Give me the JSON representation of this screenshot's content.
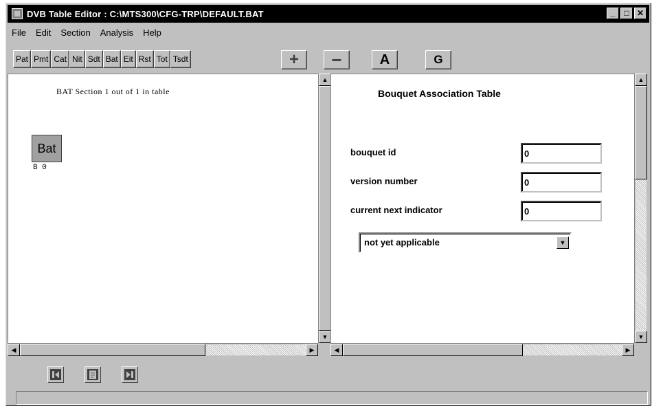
{
  "window": {
    "title": "DVB Table Editor : C:\\MTS300\\CFG-TRP\\DEFAULT.BAT",
    "controls": {
      "minimize": "_",
      "maximize": "□",
      "close": "✕"
    }
  },
  "menu": [
    "File",
    "Edit",
    "Section",
    "Analysis",
    "Help"
  ],
  "toolbar": {
    "tables": [
      "Pat",
      "Pmt",
      "Cat",
      "Nit",
      "Sdt",
      "Bat",
      "Eit",
      "Rst",
      "Tot",
      "Tsdt"
    ],
    "add": "+",
    "remove": "−",
    "a": "A",
    "g": "G"
  },
  "left_pane": {
    "section_label": "BAT Section 1 out of 1 in table",
    "node_label": "Bat",
    "node_caption": "B 0"
  },
  "right_pane": {
    "title": "Bouquet Association Table",
    "fields": [
      {
        "label": "bouquet id",
        "value": "0"
      },
      {
        "label": "version number",
        "value": "0"
      },
      {
        "label": "current next indicator",
        "value": "0"
      }
    ],
    "dropdown": {
      "selected": "not yet applicable"
    }
  },
  "scroll_icons": {
    "up": "▲",
    "down": "▼",
    "left": "◀",
    "right": "▶"
  },
  "bottom_nav": [
    {
      "icon": "previous-section-icon"
    },
    {
      "icon": "section-info-icon"
    },
    {
      "icon": "next-section-icon"
    }
  ],
  "status_text": ""
}
